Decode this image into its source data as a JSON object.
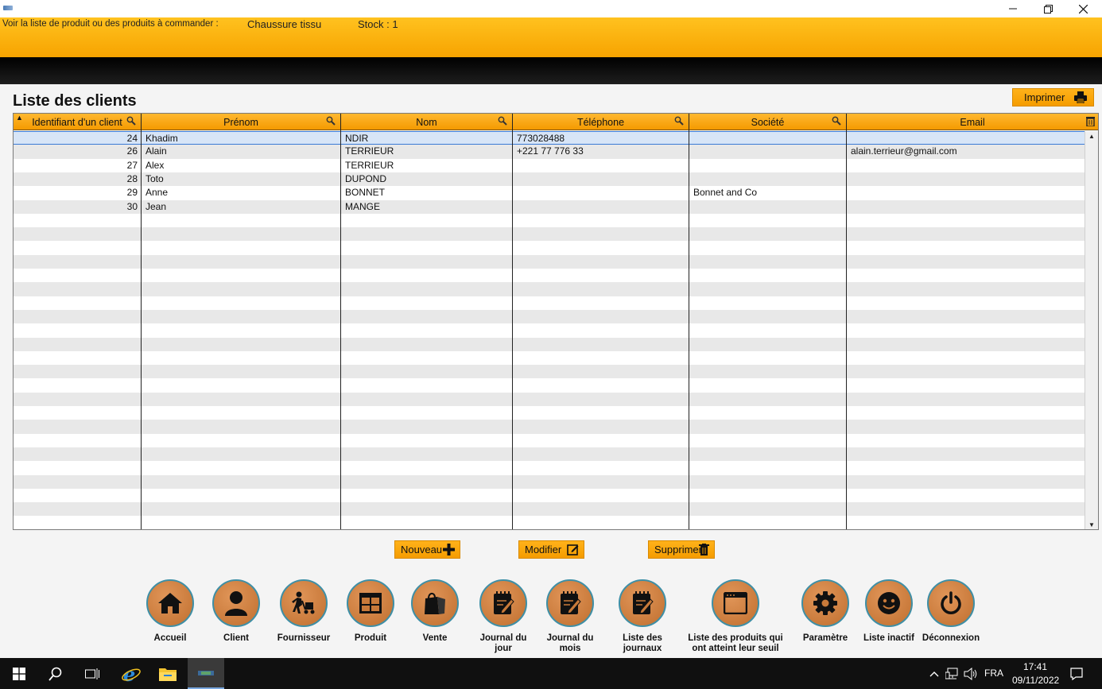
{
  "banner": {
    "label": "Voir la liste de produit ou des produits à commander :",
    "product": "Chaussure tissu",
    "stock": "Stock : 1"
  },
  "page": {
    "title": "Liste des clients",
    "print_label": "Imprimer"
  },
  "table": {
    "columns": [
      "Identifiant d'un client",
      "Prénom",
      "Nom",
      "Téléphone",
      "Société",
      "Email"
    ],
    "rows": [
      {
        "id": "24",
        "prenom": "Khadim",
        "nom": "NDIR",
        "tel": "773028488",
        "societe": "",
        "email": ""
      },
      {
        "id": "26",
        "prenom": "Alain",
        "nom": "TERRIEUR",
        "tel": "+221 77 776 33",
        "societe": "",
        "email": "alain.terrieur@gmail.com"
      },
      {
        "id": "27",
        "prenom": "Alex",
        "nom": "TERRIEUR",
        "tel": "",
        "societe": "",
        "email": ""
      },
      {
        "id": "28",
        "prenom": "Toto",
        "nom": "DUPOND",
        "tel": "",
        "societe": "",
        "email": ""
      },
      {
        "id": "29",
        "prenom": "Anne",
        "nom": "BONNET",
        "tel": "",
        "societe": "Bonnet and Co",
        "email": ""
      },
      {
        "id": "30",
        "prenom": "Jean",
        "nom": "MANGE",
        "tel": "",
        "societe": "",
        "email": ""
      }
    ],
    "selected_row": 0
  },
  "actions": {
    "new_label": "Nouveau",
    "edit_label": "Modifier",
    "delete_label": "Supprimer"
  },
  "nav": {
    "items": [
      {
        "label": "Accueil",
        "icon": "home-icon"
      },
      {
        "label": "Client",
        "icon": "user-icon"
      },
      {
        "label": "Fournisseur",
        "icon": "delivery-icon"
      },
      {
        "label": "Produit",
        "icon": "product-grid-icon"
      },
      {
        "label": "Vente",
        "icon": "shopping-bag-icon"
      },
      {
        "label": "Journal du jour",
        "icon": "notepad-icon"
      },
      {
        "label": "Journal du mois",
        "icon": "notepad-icon"
      },
      {
        "label": "Liste des journaux",
        "icon": "notepad-icon"
      },
      {
        "label": "Liste des produits qui ont atteint leur seuil de ...",
        "icon": "window-icon"
      },
      {
        "label": "Paramètre",
        "icon": "gear-icon"
      },
      {
        "label": "Liste inactif",
        "icon": "smiley-icon"
      },
      {
        "label": "Déconnexion",
        "icon": "power-icon"
      }
    ]
  },
  "taskbar": {
    "lang": "FRA",
    "time": "17:41",
    "date": "09/11/2022"
  },
  "colors": {
    "accent_orange": "#f7a300",
    "nav_circle": "#c87a3a",
    "nav_ring": "#3e8fa6",
    "selection": "#d7e5f7"
  }
}
